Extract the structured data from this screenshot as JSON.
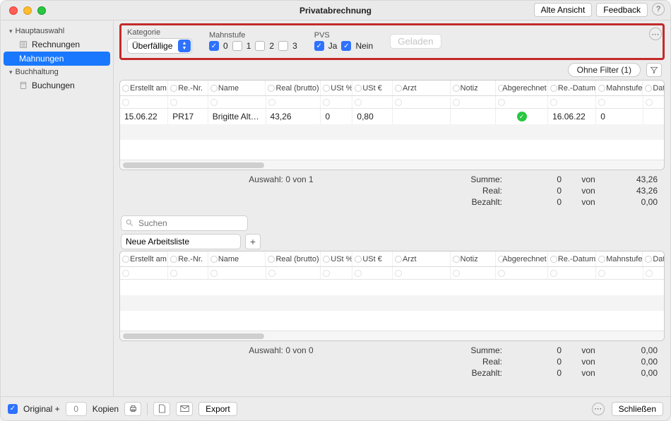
{
  "window_title": "Privatabrechnung",
  "top_buttons": {
    "alte_ansicht": "Alte Ansicht",
    "feedback": "Feedback",
    "help": "?"
  },
  "sidebar": {
    "group1": "Hauptauswahl",
    "item1": "Rechnungen",
    "item2": "Mahnungen",
    "group2": "Buchhaltung",
    "item3": "Buchungen"
  },
  "filters": {
    "kategorie_label": "Kategorie",
    "kategorie_value": "Überfällige",
    "mahnstufe_label": "Mahnstufe",
    "m0": "0",
    "m1": "1",
    "m2": "2",
    "m3": "3",
    "pvs_label": "PVS",
    "pvs_ja": "Ja",
    "pvs_nein": "Nein",
    "geladen": "Geladen"
  },
  "filter_pill": "Ohne Filter (1)",
  "table": {
    "headers": {
      "erstellt": "Erstellt am",
      "renr": "Re.-Nr.",
      "name": "Name",
      "real": "Real (brutto) €",
      "ustp": "USt %",
      "uste": "USt €",
      "arzt": "Arzt",
      "notiz": "Notiz",
      "abg": "Abgerechnet",
      "redatum": "Re.-Datum",
      "mahnstufe": "Mahnstufe",
      "dat": "Dat"
    },
    "row1": {
      "erstellt": "15.06.22",
      "renr": "PR17",
      "name": "Brigitte Alt…",
      "real": "43,26",
      "ustp": "0",
      "uste": "0,80",
      "arzt": "",
      "notiz": "",
      "abg_ok": true,
      "redatum": "16.06.22",
      "mahnstufe": "0"
    }
  },
  "summary": {
    "auswahl1": "Auswahl:  0 von 1",
    "auswahl2": "Auswahl:  0 von 0",
    "summe": "Summe:",
    "real": "Real:",
    "bezahlt": "Bezahlt:",
    "von": "von",
    "s_zero": "0",
    "s1_summe": "43,26",
    "s1_real": "43,26",
    "s1_bez": "0,00",
    "s2_summe": "0,00",
    "s2_real": "0,00",
    "s2_bez": "0,00"
  },
  "search_placeholder": "Suchen",
  "worklist_value": "Neue Arbeitsliste",
  "footer": {
    "original": "Original +",
    "kopien": "Kopien",
    "kopien_value": "0",
    "export": "Export",
    "schliessen": "Schließen"
  }
}
